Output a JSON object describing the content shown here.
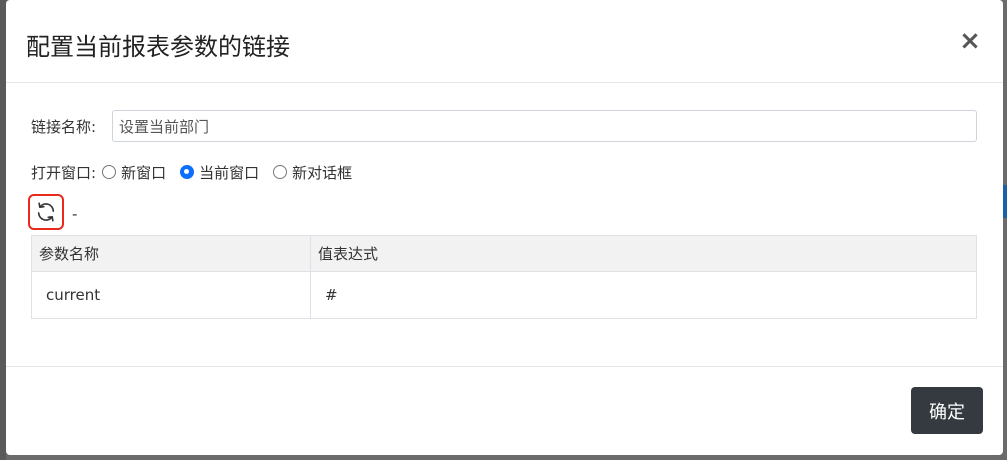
{
  "modal": {
    "title": "配置当前报表参数的链接",
    "close_label": "×"
  },
  "form": {
    "name_label": "链接名称:",
    "name_value": "设置当前部门",
    "open_label": "打开窗口:",
    "open_options": [
      {
        "label": "新窗口",
        "checked": false
      },
      {
        "label": "当前窗口",
        "checked": true
      },
      {
        "label": "新对话框",
        "checked": false
      }
    ],
    "refresh_icon": "refresh-icon",
    "dash": "-"
  },
  "table": {
    "headers": [
      "参数名称",
      "值表达式"
    ],
    "rows": [
      [
        "current",
        "#"
      ]
    ]
  },
  "footer": {
    "ok_label": "确定"
  },
  "colors": {
    "accent": "#0d6efd",
    "highlight_border": "#e8291c",
    "primary_button": "#343a40"
  }
}
